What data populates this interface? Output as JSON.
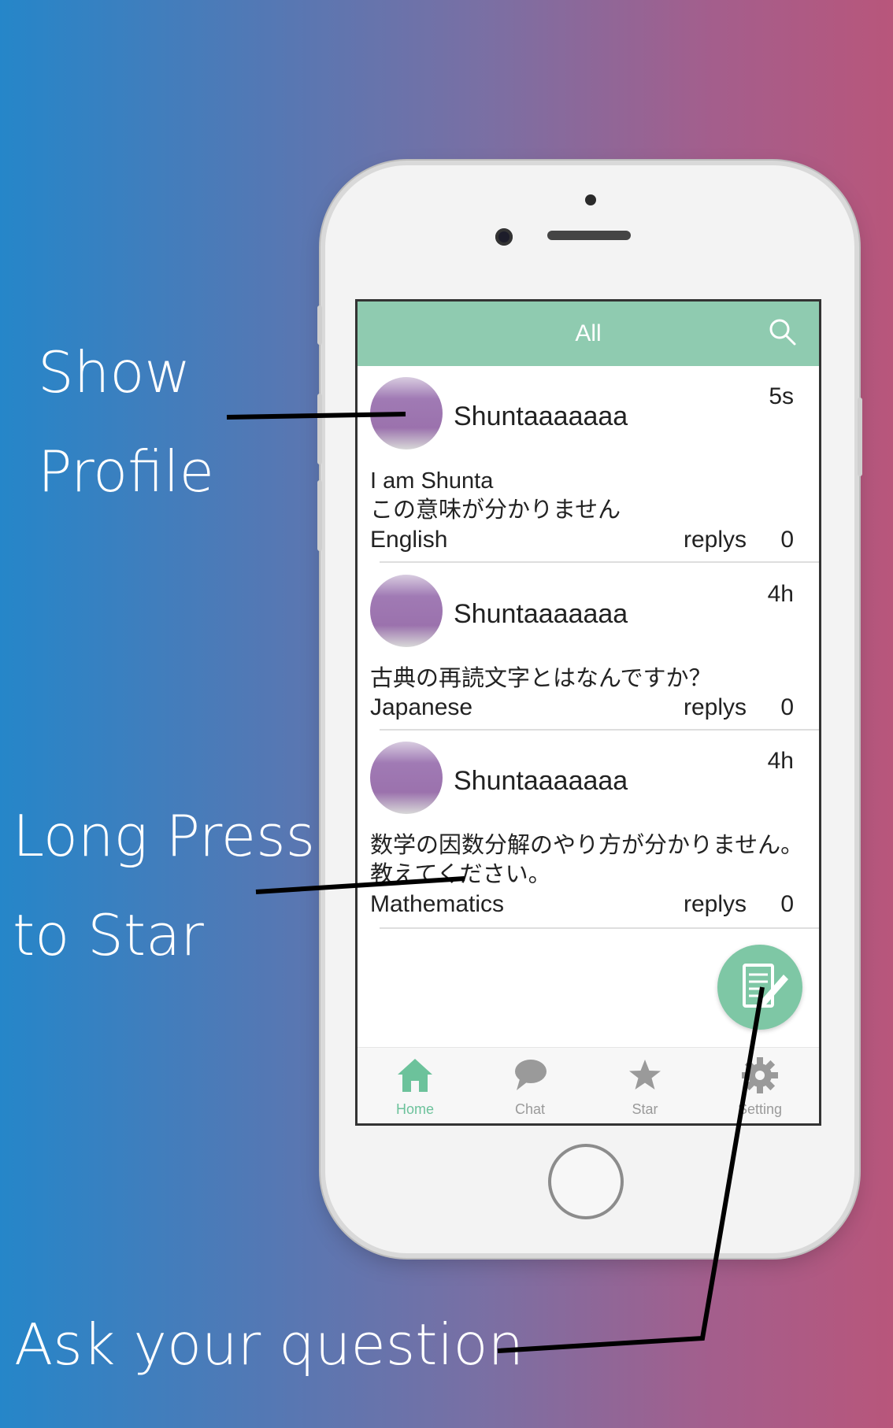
{
  "callouts": {
    "show": "Show",
    "profile": "Profile",
    "long_press": "Long Press",
    "to_star": "to Star",
    "ask": "Ask your question"
  },
  "navbar": {
    "title": "All",
    "search_icon": "search-icon"
  },
  "posts": [
    {
      "username": "Shuntaaaaaaa",
      "time": "5s",
      "text_lines": [
        "I am Shunta",
        "この意味が分かりません"
      ],
      "language": "English",
      "replies_label": "replys",
      "replies_count": "0"
    },
    {
      "username": "Shuntaaaaaaa",
      "time": "4h",
      "text_lines": [
        "古典の再読文字とはなんですか？"
      ],
      "language": "Japanese",
      "replies_label": "replys",
      "replies_count": "0"
    },
    {
      "username": "Shuntaaaaaaa",
      "time": "4h",
      "text_lines": [
        "数学の因数分解のやり方が分かりません。",
        "教えてください。"
      ],
      "language": "Mathematics",
      "replies_label": "replys",
      "replies_count": "0"
    }
  ],
  "fab": {
    "icon": "compose-icon"
  },
  "tabs": [
    {
      "label": "Home",
      "icon": "home-icon",
      "active": true
    },
    {
      "label": "Chat",
      "icon": "chat-icon",
      "active": false
    },
    {
      "label": "Star",
      "icon": "star-icon",
      "active": false
    },
    {
      "label": "Setting",
      "icon": "gear-icon",
      "active": false
    }
  ],
  "colors": {
    "accent": "#8fcbb0",
    "fab": "#7ec7a5",
    "tab_active": "#6cc29b",
    "tab_inactive": "#9a9a9a"
  }
}
